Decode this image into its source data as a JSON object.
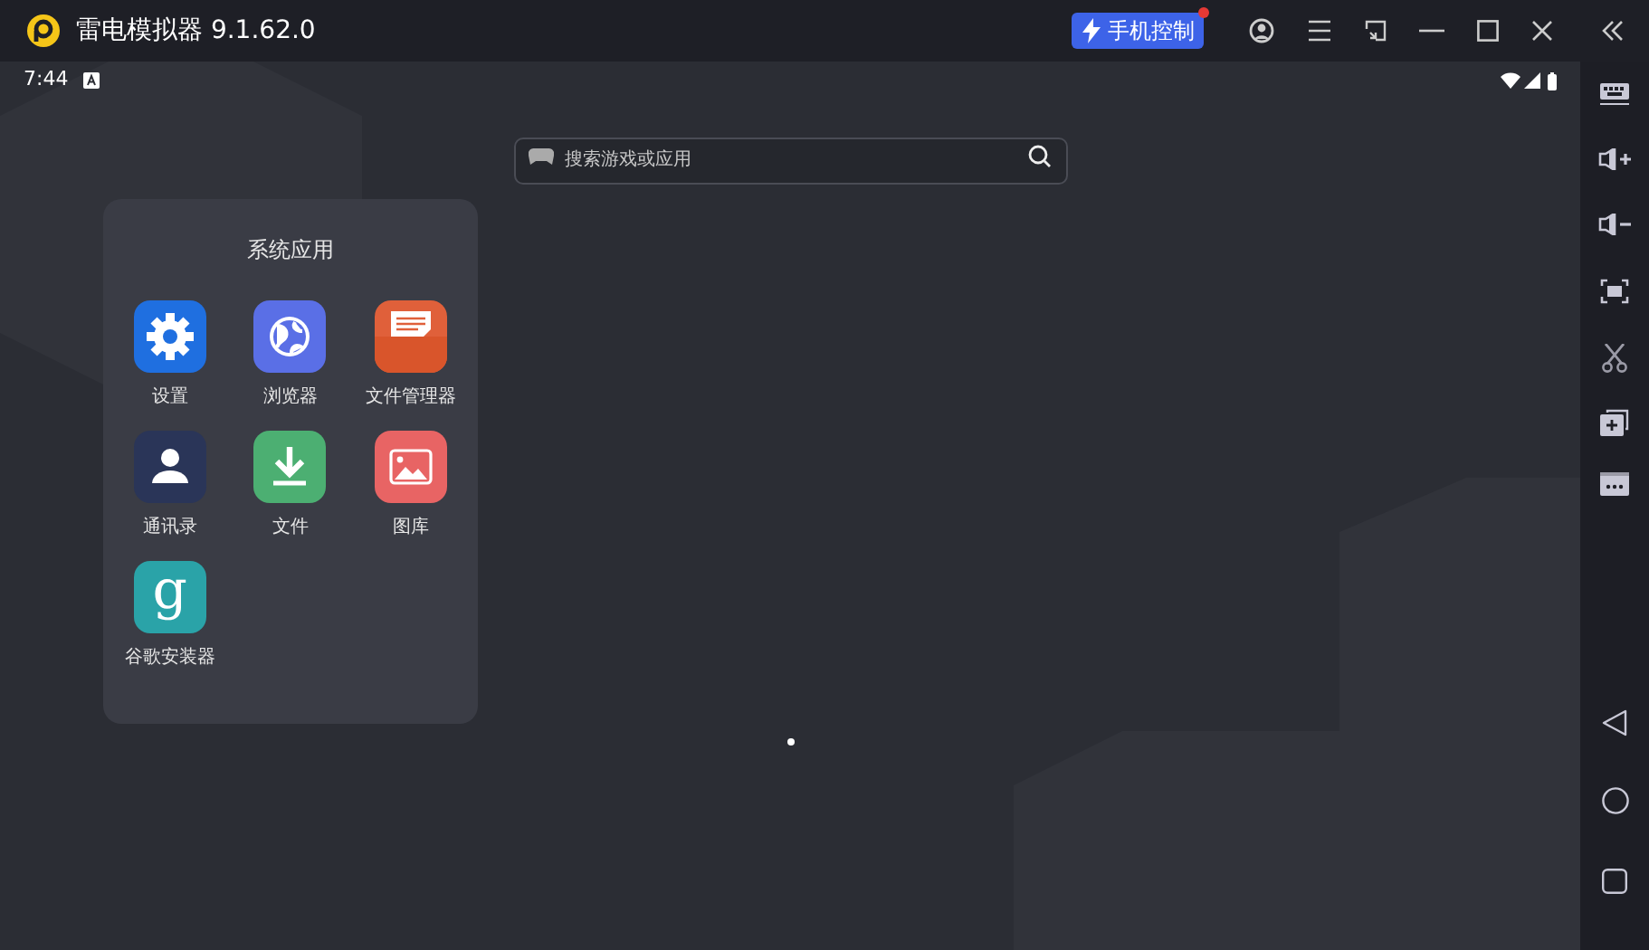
{
  "window": {
    "title": "雷电模拟器 9.1.62.0",
    "phone_control": {
      "label": "手机控制",
      "notification": true
    }
  },
  "status_bar": {
    "time": "7:44"
  },
  "search": {
    "placeholder": "搜索游戏或应用"
  },
  "folder": {
    "title": "系统应用",
    "apps": [
      {
        "label": "设置",
        "kind": "settings",
        "color": "#1f6fe0"
      },
      {
        "label": "浏览器",
        "kind": "browser",
        "color": "#5a6fe6"
      },
      {
        "label": "文件管理器",
        "kind": "file_manager",
        "color": "#e0603a"
      },
      {
        "label": "通讯录",
        "kind": "contacts",
        "color": "#2a3558"
      },
      {
        "label": "文件",
        "kind": "download",
        "color": "#4caf72"
      },
      {
        "label": "图库",
        "kind": "gallery",
        "color": "#e86464"
      },
      {
        "label": "谷歌安装器",
        "kind": "google_installer",
        "color": "#2aa3a8",
        "glyph": "g"
      }
    ]
  }
}
